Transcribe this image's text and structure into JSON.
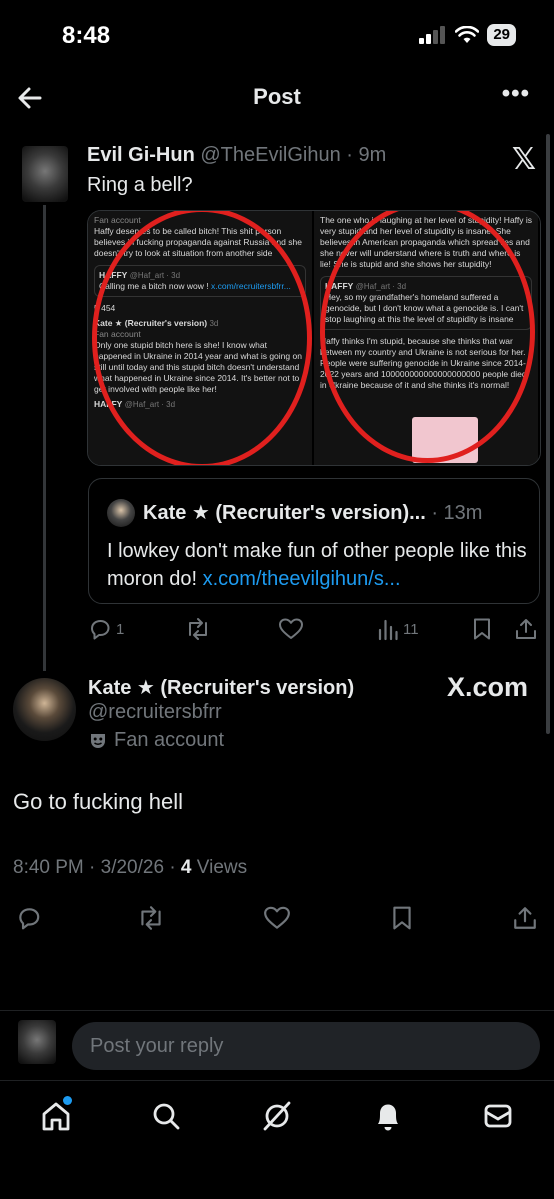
{
  "status_bar": {
    "time": "8:48",
    "battery": "29"
  },
  "header": {
    "title": "Post",
    "more": "•••"
  },
  "parent_post": {
    "name": "Evil Gi-Hun",
    "handle": "@TheEvilGihun",
    "time": "9m",
    "text": "Ring a bell?",
    "media": {
      "left": {
        "label": "Fan account",
        "text1": "Haffy deserves to be called bitch! This shit person believes in fucking propaganda against Russia and she doesn't try to look at situation from another side",
        "card_name": "HAFFY",
        "card_handle": "@Haf_art · 3d",
        "card_text": "Calling me a bitch now wow !",
        "card_link": "x.com/recruitersbfrr...",
        "stats": "5   454",
        "reply_name": "Kate ★ (Recruiter's version)",
        "reply_time": "3d",
        "reply_label": "Fan account",
        "reply_text": "Only one stupid bitch here is she! I know what happened in Ukraine in 2014 year and what is going on still until today and this stupid bitch doesn't understand what happened in Ukraine since 2014. It's better not to get involved with people like her!",
        "footer_name": "HAFFY",
        "footer_handle": "@Haf_art · 3d"
      },
      "right": {
        "text1": "The one who is laughing at her level of stupidity! Haffy is very stupid and her level of stupidity is insane! She believes in American propaganda which spread lies and she never will understand where is truth and where is lie! She is stupid and she shows her stupidity!",
        "card_name": "HAFFY",
        "card_handle": "@Haf_art · 3d",
        "card_text": "Hey, so my grandfather's homeland suffered a genocide, but I don't know what a genocide is. I can't stop laughing at this the level of stupidity is insane",
        "text2": "Haffy thinks I'm stupid, because she thinks that war between my country and Ukraine is not serious for her. People were suffering genocide in Ukraine since 2014-2022 years and 100000000000000000000 people died in Ukraine because of it and she thinks it's normal!"
      }
    },
    "quote": {
      "name": "Kate ★ (Recruiter's version)...",
      "time": "· 13m",
      "text": "I lowkey don't make fun of other people like this moron do!",
      "link": "x.com/theevilgihun/s..."
    },
    "actions": {
      "replies": "1",
      "views": "11"
    }
  },
  "main_post": {
    "name": "Kate ★ (Recruiter's version)",
    "source": "X.com",
    "handle": "@recruitersbfrr",
    "badge": "Fan account",
    "text": "Go to fucking hell",
    "timestamp": "8:40 PM · 3/20/26 · ",
    "views_count": "4",
    "views_label": " Views"
  },
  "reply": {
    "placeholder": "Post your reply"
  },
  "colors": {
    "accent": "#1d9bf0",
    "muted": "#71767b",
    "text": "#e7e9ea",
    "background": "#000000"
  }
}
